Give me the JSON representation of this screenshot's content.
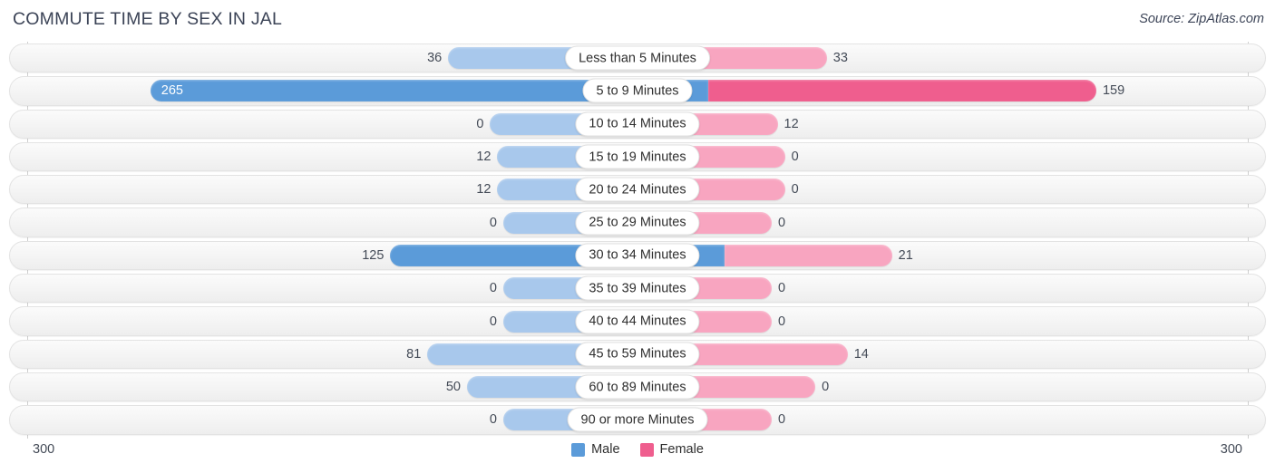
{
  "header": {
    "title": "COMMUTE TIME BY SEX IN JAL",
    "source": "Source: ZipAtlas.com"
  },
  "colors": {
    "male_strong": "#5b9bd9",
    "male_light": "#a8c8ec",
    "female_strong": "#ef5e8e",
    "female_light": "#f8a5c0",
    "track": "#f4f4f4",
    "text": "#444b57"
  },
  "axis": {
    "left_tick": "300",
    "right_tick": "300",
    "max": 300
  },
  "legend": {
    "items": [
      {
        "label": "Male",
        "color": "#5b9bd9"
      },
      {
        "label": "Female",
        "color": "#ef5e8e"
      }
    ]
  },
  "chart_data": {
    "type": "bar",
    "title": "COMMUTE TIME BY SEX IN JAL",
    "subtitle": "Source: ZipAtlas.com",
    "orientation": "horizontal-diverging",
    "xlabel": "",
    "ylabel": "",
    "xlim": [
      -300,
      300
    ],
    "axis_ticks": [
      "300",
      "300"
    ],
    "grid": false,
    "legend_position": "bottom-center",
    "categories": [
      "Less than 5 Minutes",
      "5 to 9 Minutes",
      "10 to 14 Minutes",
      "15 to 19 Minutes",
      "20 to 24 Minutes",
      "25 to 29 Minutes",
      "30 to 34 Minutes",
      "35 to 39 Minutes",
      "40 to 44 Minutes",
      "45 to 59 Minutes",
      "60 to 89 Minutes",
      "90 or more Minutes"
    ],
    "series": [
      {
        "name": "Male",
        "values": [
          36,
          265,
          0,
          12,
          12,
          0,
          125,
          0,
          0,
          81,
          50,
          0
        ]
      },
      {
        "name": "Female",
        "values": [
          33,
          159,
          12,
          0,
          0,
          0,
          21,
          0,
          0,
          14,
          0,
          0
        ]
      }
    ]
  },
  "rows": [
    {
      "category": "Less than 5 Minutes",
      "male": 36,
      "female": 33,
      "male_label": "36",
      "female_label": "33"
    },
    {
      "category": "5 to 9 Minutes",
      "male": 265,
      "female": 159,
      "male_label": "265",
      "female_label": "159"
    },
    {
      "category": "10 to 14 Minutes",
      "male": 0,
      "female": 12,
      "male_label": "0",
      "female_label": "12"
    },
    {
      "category": "15 to 19 Minutes",
      "male": 12,
      "female": 0,
      "male_label": "12",
      "female_label": "0"
    },
    {
      "category": "20 to 24 Minutes",
      "male": 12,
      "female": 0,
      "male_label": "12",
      "female_label": "0"
    },
    {
      "category": "25 to 29 Minutes",
      "male": 0,
      "female": 0,
      "male_label": "0",
      "female_label": "0"
    },
    {
      "category": "30 to 34 Minutes",
      "male": 125,
      "female": 21,
      "male_label": "125",
      "female_label": "21"
    },
    {
      "category": "35 to 39 Minutes",
      "male": 0,
      "female": 0,
      "male_label": "0",
      "female_label": "0"
    },
    {
      "category": "40 to 44 Minutes",
      "male": 0,
      "female": 0,
      "male_label": "0",
      "female_label": "0"
    },
    {
      "category": "45 to 59 Minutes",
      "male": 81,
      "female": 14,
      "male_label": "81",
      "female_label": "14"
    },
    {
      "category": "60 to 89 Minutes",
      "male": 50,
      "female": 0,
      "male_label": "50",
      "female_label": "0"
    },
    {
      "category": "90 or more Minutes",
      "male": 0,
      "female": 0,
      "male_label": "0",
      "female_label": "0"
    }
  ]
}
